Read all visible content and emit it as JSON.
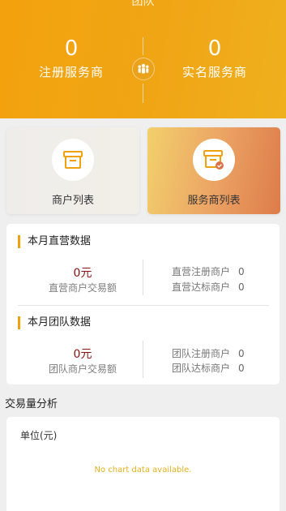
{
  "header": {
    "title": "团队",
    "registered": {
      "count": "0",
      "label": "注册服务商"
    },
    "verified": {
      "count": "0",
      "label": "实名服务商"
    }
  },
  "cards": {
    "merchant_list": "商户列表",
    "provider_list": "服务商列表"
  },
  "direct": {
    "title": "本月直营数据",
    "amount": "0元",
    "amount_label": "直营商户交易额",
    "registered_label": "直营注册商户",
    "registered_value": "0",
    "qualified_label": "直营达标商户",
    "qualified_value": "0"
  },
  "team": {
    "title": "本月团队数据",
    "amount": "0元",
    "amount_label": "团队商户交易额",
    "registered_label": "团队注册商户",
    "registered_value": "0",
    "qualified_label": "团队达标商户",
    "qualified_value": "0"
  },
  "analysis": {
    "title": "交易量分析",
    "unit": "单位(元)",
    "empty": "No chart data available."
  },
  "colors": {
    "accent": "#f0a10e",
    "amount_red": "#8b1212"
  }
}
